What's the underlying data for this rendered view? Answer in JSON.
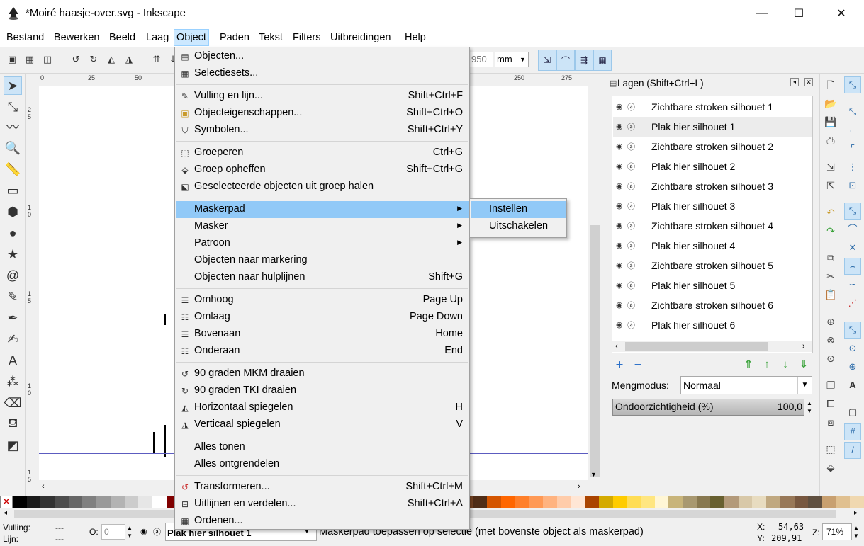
{
  "window": {
    "title": "*Moiré haasje-over.svg - Inkscape",
    "minimize_glyph": "—",
    "maximize_glyph": "☐",
    "close_glyph": "✕"
  },
  "menubar": {
    "items": [
      "Bestand",
      "Bewerken",
      "Beeld",
      "Laag",
      "Object",
      "Paden",
      "Tekst",
      "Filters",
      "Uitbreidingen",
      "Help"
    ],
    "active": "Object"
  },
  "toolbar": {
    "coord_value": "950",
    "unit": "mm"
  },
  "rulers": {
    "top_ticks": [
      "0",
      "25",
      "50",
      "250",
      "275"
    ],
    "left_ticks": [
      "2",
      "5",
      "1",
      "0",
      "1",
      "5",
      "1",
      "0",
      "1",
      "5"
    ]
  },
  "object_menu": {
    "items": [
      {
        "label": "Objecten...",
        "shortcut": "",
        "icon": "objects-icon"
      },
      {
        "label": "Selectiesets...",
        "shortcut": "",
        "icon": "selection-sets-icon"
      },
      {
        "label": "Vulling en lijn...",
        "shortcut": "Shift+Ctrl+F",
        "icon": "fill-stroke-icon"
      },
      {
        "label": "Objecteigenschappen...",
        "shortcut": "Shift+Ctrl+O",
        "icon": "object-properties-icon"
      },
      {
        "label": "Symbolen...",
        "shortcut": "Shift+Ctrl+Y",
        "icon": "symbols-icon"
      },
      {
        "label": "Groeperen",
        "shortcut": "Ctrl+G",
        "icon": "group-icon"
      },
      {
        "label": "Groep opheffen",
        "shortcut": "Shift+Ctrl+G",
        "icon": "ungroup-icon"
      },
      {
        "label": "Geselecteerde objecten uit groep halen",
        "shortcut": "",
        "icon": "pop-from-group-icon"
      },
      {
        "label": "Maskerpad",
        "shortcut": "",
        "icon": "",
        "submenu": true
      },
      {
        "label": "Masker",
        "shortcut": "",
        "icon": "",
        "submenu": true
      },
      {
        "label": "Patroon",
        "shortcut": "",
        "icon": "",
        "submenu": true
      },
      {
        "label": "Objecten naar markering",
        "shortcut": "",
        "icon": ""
      },
      {
        "label": "Objecten naar hulplijnen",
        "shortcut": "Shift+G",
        "icon": ""
      },
      {
        "label": "Omhoog",
        "shortcut": "Page Up",
        "icon": "raise-icon"
      },
      {
        "label": "Omlaag",
        "shortcut": "Page Down",
        "icon": "lower-icon"
      },
      {
        "label": "Bovenaan",
        "shortcut": "Home",
        "icon": "raise-to-top-icon"
      },
      {
        "label": "Onderaan",
        "shortcut": "End",
        "icon": "lower-to-bottom-icon"
      },
      {
        "label": "90 graden MKM draaien",
        "shortcut": "",
        "icon": "rotate-ccw-icon"
      },
      {
        "label": "90 graden TKI draaien",
        "shortcut": "",
        "icon": "rotate-cw-icon"
      },
      {
        "label": "Horizontaal spiegelen",
        "shortcut": "H",
        "icon": "flip-horizontal-icon"
      },
      {
        "label": "Verticaal spiegelen",
        "shortcut": "V",
        "icon": "flip-vertical-icon"
      },
      {
        "label": "Alles tonen",
        "shortcut": "",
        "icon": ""
      },
      {
        "label": "Alles ontgrendelen",
        "shortcut": "",
        "icon": ""
      },
      {
        "label": "Transformeren...",
        "shortcut": "Shift+Ctrl+M",
        "icon": "transform-icon"
      },
      {
        "label": "Uitlijnen en verdelen...",
        "shortcut": "Shift+Ctrl+A",
        "icon": "align-distribute-icon"
      },
      {
        "label": "Ordenen...",
        "shortcut": "",
        "icon": "arrange-icon"
      }
    ],
    "highlighted": "Maskerpad"
  },
  "clip_submenu": {
    "items": [
      "Instellen",
      "Uitschakelen"
    ],
    "highlighted": "Instellen"
  },
  "layers_panel": {
    "title": "Lagen (Shift+Ctrl+L)",
    "layers": [
      "Zichtbare stroken silhouet 1",
      "Plak hier silhouet 1",
      "Zichtbare stroken silhouet 2",
      "Plak hier silhouet 2",
      "Zichtbare stroken silhouet 3",
      "Plak hier silhouet 3",
      "Zichtbare stroken silhouet 4",
      "Plak hier silhouet 4",
      "Zichtbare stroken silhouet 5",
      "Plak hier silhouet 5",
      "Zichtbare stroken silhouet 6",
      "Plak hier silhouet 6"
    ],
    "selected": "Plak hier silhouet 1",
    "blend_label": "Mengmodus:",
    "blend_value": "Normaal",
    "opacity_label": "Ondoorzichtigheid (%)",
    "opacity_value": "100,0"
  },
  "statusbar": {
    "fill_label": "Vulling:",
    "fill_value": "---",
    "stroke_label": "Lijn:",
    "stroke_value": "---",
    "opacity_label": "O:",
    "opacity_value": "0",
    "current_layer": "Plak hier silhouet 1",
    "message": "Maskerpad toepassen op selectie (met bovenste object als maskerpad)",
    "x_label": "X:",
    "x_value": "54,63",
    "y_label": "Y:",
    "y_value": "209,91",
    "zoom_label": "Z:",
    "zoom_value": "71%"
  },
  "palette": [
    "#000000",
    "#1a1a1a",
    "#333333",
    "#4d4d4d",
    "#666666",
    "#808080",
    "#999999",
    "#b3b3b3",
    "#cccccc",
    "#e6e6e6",
    "#ffffff",
    "#800000",
    "#ff0000",
    "#808000",
    "#ffff00",
    "#008000",
    "#00ff00",
    "#008080",
    "#00ffff",
    "#000080",
    "#0000ff",
    "#800080",
    "#ff00ff",
    "#552200",
    "#803300",
    "#a04400",
    "#c05500",
    "#d87a2a",
    "#e89a55",
    "#f0b27a",
    "#c87137",
    "#a05a2c",
    "#784421",
    "#502d16",
    "#d45500",
    "#ff6600",
    "#ff7f2a",
    "#ff9955",
    "#ffb380",
    "#ffccaa",
    "#ffe6d5",
    "#aa4400",
    "#d4aa00",
    "#ffcc00",
    "#ffdd55",
    "#ffe680",
    "#fff6d5",
    "#c8b47a",
    "#a89870",
    "#887850",
    "#686030",
    "#b39a7a",
    "#d8c8a8",
    "#e8dcc0",
    "#c0a880",
    "#987858",
    "#785840",
    "#605040",
    "#c8a070",
    "#e0c090",
    "#f0d8b0"
  ],
  "colors": {
    "menu_highlight": "#91c9f7",
    "menubar_active": "#cce8ff",
    "toggle_on": "#cce4f7"
  }
}
